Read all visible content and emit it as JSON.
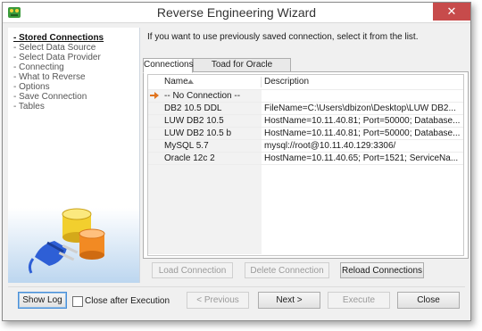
{
  "window": {
    "title": "Reverse Engineering Wizard"
  },
  "steps": [
    "- Stored Connections",
    "- Select Data Source",
    "- Select Data Provider",
    "- Connecting",
    "- What to Reverse",
    "- Options",
    "- Save Connection",
    "- Tables"
  ],
  "instruction": "If you want to use previously saved connection, select it from the list.",
  "tabs": [
    "Connections",
    "Toad for Oracle Connections"
  ],
  "grid": {
    "columns": [
      "Name",
      "Description"
    ],
    "rows": [
      {
        "name": "-- No Connection --",
        "description": ""
      },
      {
        "name": "DB2 10.5 DDL",
        "description": "FileName=C:\\Users\\dbizon\\Desktop\\LUW DB2..."
      },
      {
        "name": "LUW DB2 10.5",
        "description": "HostName=10.11.40.81; Port=50000; Database..."
      },
      {
        "name": "LUW DB2 10.5 b",
        "description": "HostName=10.11.40.81; Port=50000; Database..."
      },
      {
        "name": "MySQL 5.7",
        "description": "mysql://root@10.11.40.129:3306/"
      },
      {
        "name": "Oracle 12c 2",
        "description": "HostName=10.11.40.65; Port=1521; ServiceNa..."
      }
    ]
  },
  "buttons": {
    "load": "Load Connection",
    "delete": "Delete Connection",
    "reload": "Reload Connections",
    "show_log": "Show Log",
    "previous": "< Previous",
    "next": "Next >",
    "execute": "Execute",
    "close": "Close"
  },
  "close_after_execution": "Close after Execution",
  "icons": {
    "title": "toad-app-icon",
    "row_pointer": "row-pointer-arrow-icon",
    "sort": "sort-ascending-icon",
    "art": "database-plug-illustration"
  },
  "colors": {
    "pointer": "#e0741f",
    "sidebar_gradient": "#bcd6ef",
    "close_button": "#c74b4b"
  }
}
